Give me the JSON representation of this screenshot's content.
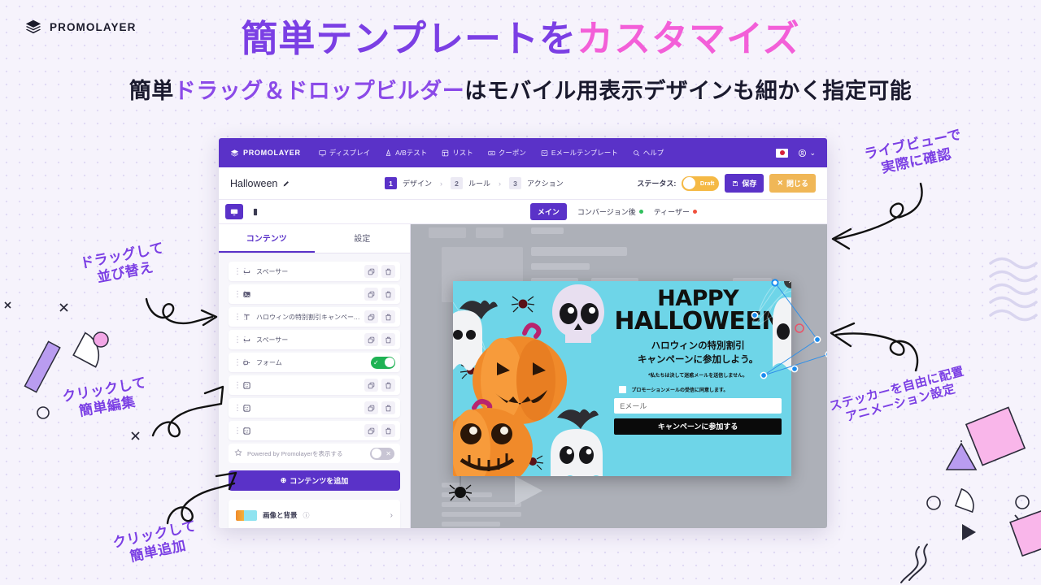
{
  "brand": {
    "name": "PROMOLAYER",
    "icon": "layers-icon"
  },
  "headline": {
    "part1": "簡単テンプレートを",
    "part2": "カスタマイズ"
  },
  "subheadline": {
    "part1": "簡単",
    "part2": "ドラッグ＆ドロップビルダー",
    "part3": "はモバイル用表示デザインも細かく指定可能"
  },
  "app": {
    "topbar": {
      "logo": "PROMOLAYER",
      "nav": [
        {
          "label": "ディスプレイ",
          "icon": "display-icon"
        },
        {
          "label": "A/Bテスト",
          "icon": "ab-test-icon"
        },
        {
          "label": "リスト",
          "icon": "list-icon"
        },
        {
          "label": "クーポン",
          "icon": "coupon-icon"
        },
        {
          "label": "Eメールテンプレート",
          "icon": "email-template-icon"
        },
        {
          "label": "ヘルプ",
          "icon": "search-icon"
        }
      ],
      "flag": "japan-flag-icon",
      "account_icon": "account-icon"
    },
    "subbar": {
      "campaign_name": "Halloween",
      "edit_icon": "pencil-icon",
      "steps": [
        {
          "num": "1",
          "label": "デザイン"
        },
        {
          "num": "2",
          "label": "ルール"
        },
        {
          "num": "3",
          "label": "アクション"
        }
      ],
      "status_label": "ステータス:",
      "status_value": "Draft",
      "save_label": "保存",
      "close_label": "閉じる"
    },
    "tabbar": {
      "device_desktop": "desktop-icon",
      "device_mobile": "mobile-icon",
      "tabs": [
        {
          "label": "メイン",
          "dot": ""
        },
        {
          "label": "コンバージョン後",
          "dot": "green"
        },
        {
          "label": "ティーザー",
          "dot": "red"
        }
      ]
    },
    "sidebar": {
      "tabs": [
        {
          "label": "コンテンツ"
        },
        {
          "label": "設定"
        }
      ],
      "items": [
        {
          "label": "スペーサー",
          "icon": "spacer-icon",
          "control": "actions"
        },
        {
          "label": "",
          "icon": "image-icon",
          "control": "actions"
        },
        {
          "label": "ハロウィンの特別割引キャンペーン...",
          "icon": "text-icon",
          "control": "actions"
        },
        {
          "label": "スペーサー",
          "icon": "spacer-icon",
          "control": "actions"
        },
        {
          "label": "フォーム",
          "icon": "form-icon",
          "control": "toggle-on"
        },
        {
          "label": "",
          "icon": "sticker-icon",
          "control": "actions"
        },
        {
          "label": "",
          "icon": "sticker-icon",
          "control": "actions"
        },
        {
          "label": "",
          "icon": "sticker-icon",
          "control": "actions"
        }
      ],
      "powered": {
        "label": "Powered by Promolayerを表示する",
        "icon": "star-icon",
        "toggle": "off"
      },
      "add_button": "コンテンツを追加",
      "image_bg": {
        "label": "画像と背景",
        "help_icon": "help-circle-icon",
        "chevron": "chevron-right-icon"
      }
    },
    "popup": {
      "title_line1": "HAPPY",
      "title_line2": "HALLOWEEN",
      "sub_line1": "ハロウィンの特別割引",
      "sub_line2": "キャンペーンに参加しよう。",
      "fine_print": "*私たちは決して迷惑メールを送信しません。",
      "consent": "プロモーションメールの受信に同意します。",
      "email_placeholder": "Eメール",
      "cta": "キャンペーンに参加する",
      "close_icon": "close-icon"
    }
  },
  "annotations": [
    {
      "line1": "ドラッグして",
      "line2": "並び替え"
    },
    {
      "line1": "クリックして",
      "line2": "簡単編集"
    },
    {
      "line1": "クリックして",
      "line2": "簡単追加"
    },
    {
      "line1": "ライブビューで",
      "line2": "実際に確認"
    },
    {
      "line1": "ステッカーを自由に配置",
      "line2": "アニメーション設定"
    }
  ],
  "colors": {
    "brand_purple": "#5a32c8",
    "headline_purple": "#7b3fe4",
    "headline_pink": "#f35fd8",
    "accent_yellow": "#f0b757",
    "toggle_green": "#1fb254",
    "popup_bg": "#6ed5e8",
    "page_bg": "#f6f3fc"
  }
}
